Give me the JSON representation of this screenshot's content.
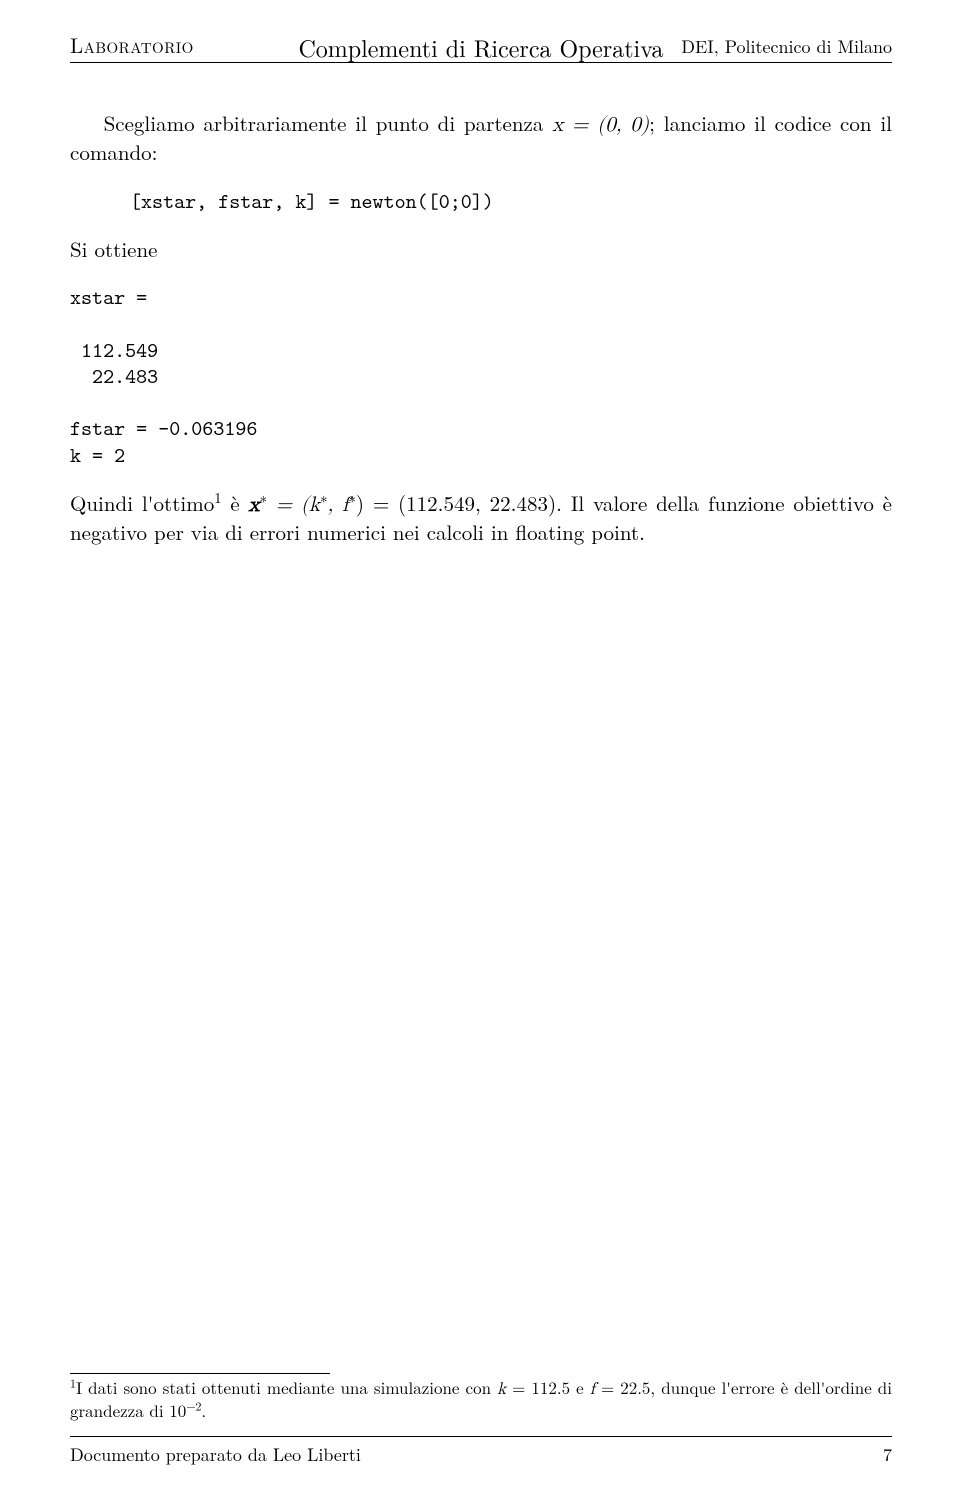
{
  "header": {
    "left": "Laboratorio",
    "center": "Complementi di Ricerca Operativa",
    "right": "DEI, Politecnico di Milano"
  },
  "body": {
    "p1_a": "Scegliamo arbitrariamente il punto di partenza ",
    "p1_math": "x = (0, 0)",
    "p1_b": "; lanciamo il codice con il comando:",
    "code1": "[xstar, fstar, k] = newton([0;0])",
    "p2": "Si ottiene",
    "code2": "xstar =\n\n 112.549\n  22.483\n\nfstar = -0.063196\nk = 2",
    "p3_a": "Quindi l'ottimo",
    "p3_sup": "1",
    "p3_b": " è ",
    "p3_math1": "x",
    "p3_math1b": "∗",
    "p3_math1c": " = (k",
    "p3_math1d": "∗",
    "p3_math1e": ", f",
    "p3_math1f": "∗",
    "p3_math1g": ") = (112.549, 22.483)",
    "p3_c": ". Il valore della funzione obiettivo è negativo per via di errori numerici nei calcoli in floating point."
  },
  "footnote": {
    "marker": "1",
    "text_a": "I dati sono stati ottenuti mediante una simulazione con ",
    "k_sym": "k",
    "k_eq": " = 112.5 e ",
    "f_sym": "f",
    "f_eq": " = 22.5, dunque l'errore è dell'ordine di grandezza di 10",
    "exp": "−2",
    "dot": "."
  },
  "footer": {
    "prepared": "Documento preparato da Leo Liberti",
    "page": "7"
  }
}
